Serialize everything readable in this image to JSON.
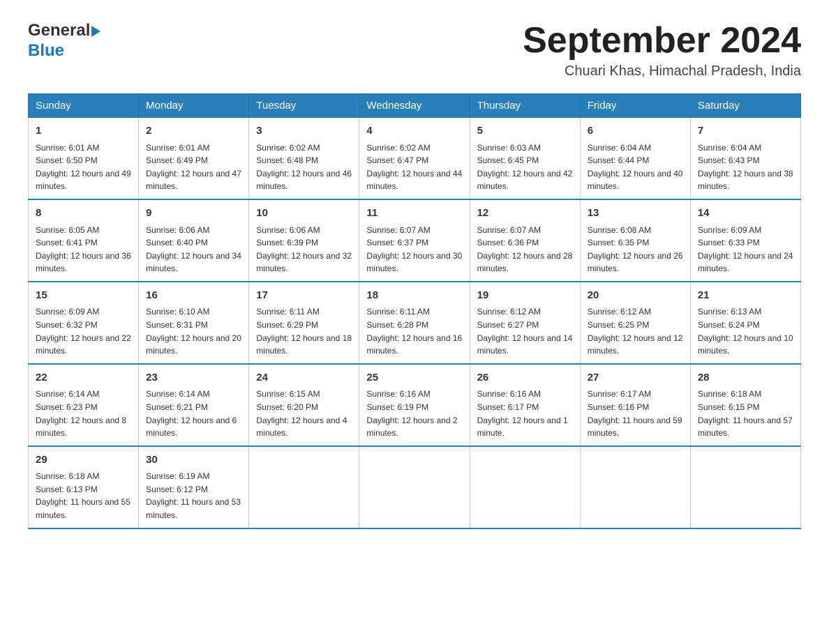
{
  "logo": {
    "text_general": "General",
    "text_blue": "Blue"
  },
  "title": "September 2024",
  "location": "Chuari Khas, Himachal Pradesh, India",
  "days_of_week": [
    "Sunday",
    "Monday",
    "Tuesday",
    "Wednesday",
    "Thursday",
    "Friday",
    "Saturday"
  ],
  "weeks": [
    [
      {
        "day": "1",
        "sunrise": "6:01 AM",
        "sunset": "6:50 PM",
        "daylight": "12 hours and 49 minutes."
      },
      {
        "day": "2",
        "sunrise": "6:01 AM",
        "sunset": "6:49 PM",
        "daylight": "12 hours and 47 minutes."
      },
      {
        "day": "3",
        "sunrise": "6:02 AM",
        "sunset": "6:48 PM",
        "daylight": "12 hours and 46 minutes."
      },
      {
        "day": "4",
        "sunrise": "6:02 AM",
        "sunset": "6:47 PM",
        "daylight": "12 hours and 44 minutes."
      },
      {
        "day": "5",
        "sunrise": "6:03 AM",
        "sunset": "6:45 PM",
        "daylight": "12 hours and 42 minutes."
      },
      {
        "day": "6",
        "sunrise": "6:04 AM",
        "sunset": "6:44 PM",
        "daylight": "12 hours and 40 minutes."
      },
      {
        "day": "7",
        "sunrise": "6:04 AM",
        "sunset": "6:43 PM",
        "daylight": "12 hours and 38 minutes."
      }
    ],
    [
      {
        "day": "8",
        "sunrise": "6:05 AM",
        "sunset": "6:41 PM",
        "daylight": "12 hours and 36 minutes."
      },
      {
        "day": "9",
        "sunrise": "6:06 AM",
        "sunset": "6:40 PM",
        "daylight": "12 hours and 34 minutes."
      },
      {
        "day": "10",
        "sunrise": "6:06 AM",
        "sunset": "6:39 PM",
        "daylight": "12 hours and 32 minutes."
      },
      {
        "day": "11",
        "sunrise": "6:07 AM",
        "sunset": "6:37 PM",
        "daylight": "12 hours and 30 minutes."
      },
      {
        "day": "12",
        "sunrise": "6:07 AM",
        "sunset": "6:36 PM",
        "daylight": "12 hours and 28 minutes."
      },
      {
        "day": "13",
        "sunrise": "6:08 AM",
        "sunset": "6:35 PM",
        "daylight": "12 hours and 26 minutes."
      },
      {
        "day": "14",
        "sunrise": "6:09 AM",
        "sunset": "6:33 PM",
        "daylight": "12 hours and 24 minutes."
      }
    ],
    [
      {
        "day": "15",
        "sunrise": "6:09 AM",
        "sunset": "6:32 PM",
        "daylight": "12 hours and 22 minutes."
      },
      {
        "day": "16",
        "sunrise": "6:10 AM",
        "sunset": "6:31 PM",
        "daylight": "12 hours and 20 minutes."
      },
      {
        "day": "17",
        "sunrise": "6:11 AM",
        "sunset": "6:29 PM",
        "daylight": "12 hours and 18 minutes."
      },
      {
        "day": "18",
        "sunrise": "6:11 AM",
        "sunset": "6:28 PM",
        "daylight": "12 hours and 16 minutes."
      },
      {
        "day": "19",
        "sunrise": "6:12 AM",
        "sunset": "6:27 PM",
        "daylight": "12 hours and 14 minutes."
      },
      {
        "day": "20",
        "sunrise": "6:12 AM",
        "sunset": "6:25 PM",
        "daylight": "12 hours and 12 minutes."
      },
      {
        "day": "21",
        "sunrise": "6:13 AM",
        "sunset": "6:24 PM",
        "daylight": "12 hours and 10 minutes."
      }
    ],
    [
      {
        "day": "22",
        "sunrise": "6:14 AM",
        "sunset": "6:23 PM",
        "daylight": "12 hours and 8 minutes."
      },
      {
        "day": "23",
        "sunrise": "6:14 AM",
        "sunset": "6:21 PM",
        "daylight": "12 hours and 6 minutes."
      },
      {
        "day": "24",
        "sunrise": "6:15 AM",
        "sunset": "6:20 PM",
        "daylight": "12 hours and 4 minutes."
      },
      {
        "day": "25",
        "sunrise": "6:16 AM",
        "sunset": "6:19 PM",
        "daylight": "12 hours and 2 minutes."
      },
      {
        "day": "26",
        "sunrise": "6:16 AM",
        "sunset": "6:17 PM",
        "daylight": "12 hours and 1 minute."
      },
      {
        "day": "27",
        "sunrise": "6:17 AM",
        "sunset": "6:16 PM",
        "daylight": "11 hours and 59 minutes."
      },
      {
        "day": "28",
        "sunrise": "6:18 AM",
        "sunset": "6:15 PM",
        "daylight": "11 hours and 57 minutes."
      }
    ],
    [
      {
        "day": "29",
        "sunrise": "6:18 AM",
        "sunset": "6:13 PM",
        "daylight": "11 hours and 55 minutes."
      },
      {
        "day": "30",
        "sunrise": "6:19 AM",
        "sunset": "6:12 PM",
        "daylight": "11 hours and 53 minutes."
      },
      null,
      null,
      null,
      null,
      null
    ]
  ]
}
